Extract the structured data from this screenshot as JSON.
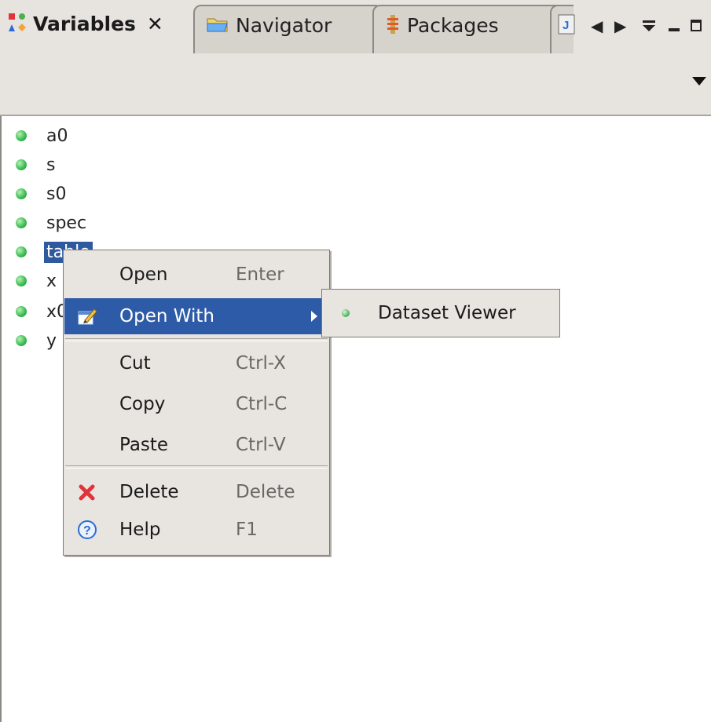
{
  "tabs": {
    "active": {
      "label": "Variables",
      "icon": "variables-icon"
    },
    "navigator": {
      "label": "Navigator",
      "icon": "folder-icon"
    },
    "packages": {
      "label": "Packages",
      "icon": "packages-icon"
    },
    "java": {
      "icon": "java-file-icon"
    }
  },
  "tab_controls": [
    "scroll-left-icon",
    "scroll-right-icon",
    "view-menu-icon",
    "minimize-icon",
    "maximize-icon"
  ],
  "variables": [
    {
      "name": "a0",
      "selected": false
    },
    {
      "name": "s",
      "selected": false
    },
    {
      "name": "s0",
      "selected": false
    },
    {
      "name": "spec",
      "selected": false
    },
    {
      "name": "table",
      "selected": true
    },
    {
      "name": "x",
      "selected": false
    },
    {
      "name": "x0",
      "selected": false
    },
    {
      "name": "y",
      "selected": false
    }
  ],
  "context_menu": {
    "items": [
      {
        "label": "Open",
        "accel": "Enter",
        "icon": null
      },
      {
        "label": "Open With",
        "accel": "",
        "icon": "open-with-icon",
        "has_submenu": true,
        "highlighted": true
      },
      {
        "label": "Cut",
        "accel": "Ctrl-X",
        "icon": null
      },
      {
        "label": "Copy",
        "accel": "Ctrl-C",
        "icon": null
      },
      {
        "label": "Paste",
        "accel": "Ctrl-V",
        "icon": null
      },
      {
        "label": "Delete",
        "accel": "Delete",
        "icon": "delete-icon"
      },
      {
        "label": "Help",
        "accel": "F1",
        "icon": "help-icon"
      }
    ]
  },
  "submenu": {
    "items": [
      {
        "label": "Dataset Viewer",
        "icon": "dataset-icon"
      }
    ]
  },
  "colors": {
    "selection": "#2f5a9e",
    "menu_highlight": "#2e5ba8",
    "panel_bg": "#e7e4df",
    "variable_dot": "#3fbf56"
  }
}
